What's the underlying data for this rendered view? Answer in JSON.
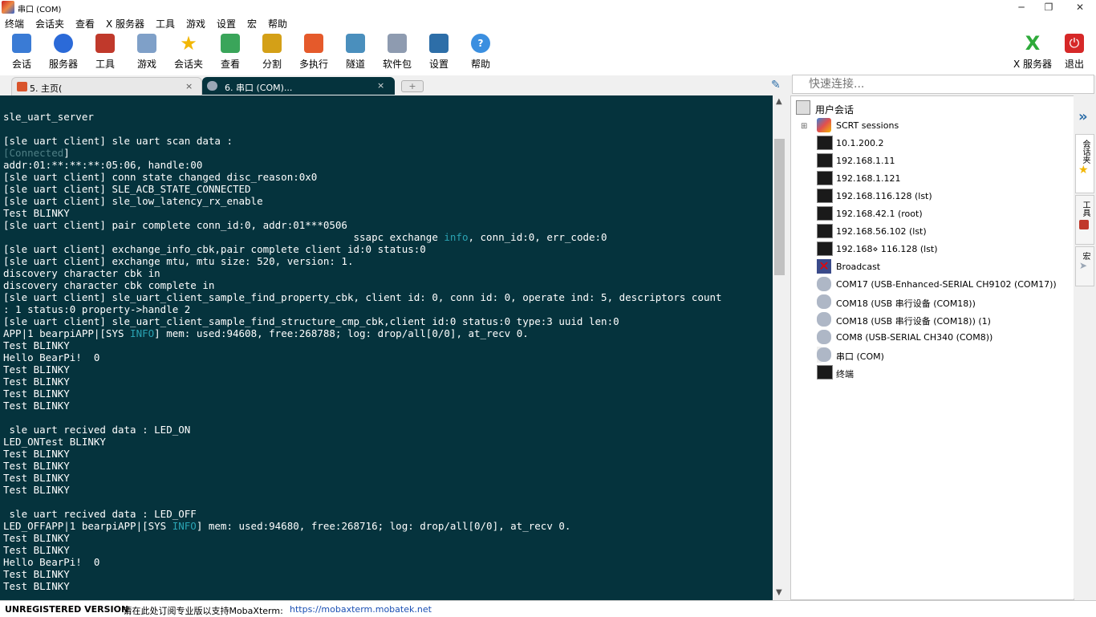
{
  "window": {
    "title": "串口 (COM)",
    "minimize": "─",
    "maximize": "❐",
    "close": "✕"
  },
  "menu": [
    "终端",
    "会话夹",
    "查看",
    "X 服务器",
    "工具",
    "游戏",
    "设置",
    "宏",
    "帮助"
  ],
  "toolbar": {
    "left": [
      {
        "label": "会话",
        "icon": "session-icon",
        "color": "#3a7bd5"
      },
      {
        "label": "服务器",
        "icon": "globe-icon",
        "color": "#2b6ad8"
      },
      {
        "label": "工具",
        "icon": "tools-icon",
        "color": "#c0392b"
      },
      {
        "label": "游戏",
        "icon": "gamepad-icon",
        "color": "#7fa0c8"
      },
      {
        "label": "会话夹",
        "icon": "star-icon",
        "color": "#f2b705"
      },
      {
        "label": "查看",
        "icon": "view-icon",
        "color": "#3aa55a"
      },
      {
        "label": "分割",
        "icon": "split-icon",
        "color": "#d4a017"
      },
      {
        "label": "多执行",
        "icon": "multiexec-icon",
        "color": "#e55a2b"
      },
      {
        "label": "隧道",
        "icon": "tunnel-icon",
        "color": "#4a8fbd"
      },
      {
        "label": "软件包",
        "icon": "packages-icon",
        "color": "#8e9bb0"
      },
      {
        "label": "设置",
        "icon": "settings-icon",
        "color": "#2d6ea8"
      },
      {
        "label": "帮助",
        "icon": "help-icon",
        "color": "#3b8fe0"
      }
    ],
    "right": [
      {
        "label": "X 服务器",
        "icon": "xserver-icon",
        "color": "#2eaa3a"
      },
      {
        "label": "退出",
        "icon": "power-icon",
        "color": "#d62828"
      }
    ]
  },
  "tabs": [
    {
      "label": "5. 主页(",
      "close": "×",
      "icon": "home-icon"
    },
    {
      "label": "6. 串口 (COM)...",
      "close": "×",
      "icon": "serial-icon"
    }
  ],
  "terminal": {
    "lines": [
      [
        {
          "t": "sle_uart_server"
        }
      ],
      [
        {
          "t": ""
        }
      ],
      [
        {
          "t": "[sle uart client] sle uart scan data :"
        }
      ],
      [
        {
          "t": "[",
          "c": "g"
        },
        {
          "t": "Connected",
          "c": "g"
        },
        {
          "t": "]"
        }
      ],
      [
        {
          "t": "addr:01:**:**:**:05:06, handle:00"
        }
      ],
      [
        {
          "t": "[sle uart client] conn state changed disc_reason:0x0"
        }
      ],
      [
        {
          "t": "[sle uart client] SLE_ACB_STATE_CONNECTED"
        }
      ],
      [
        {
          "t": "[sle uart client] sle_low_latency_rx_enable"
        }
      ],
      [
        {
          "t": "Test BLINKY"
        }
      ],
      [
        {
          "t": "[sle uart client] pair complete conn_id:0, addr:01***0506"
        }
      ],
      [
        {
          "t": "                                                          ssapc exchange "
        },
        {
          "t": "info",
          "c": "i"
        },
        {
          "t": ", conn_id:0, err_code:0"
        }
      ],
      [
        {
          "t": "[sle uart client] exchange_info_cbk,pair complete client id:0 status:0"
        }
      ],
      [
        {
          "t": "[sle uart client] exchange mtu, mtu size: 520, version: 1."
        }
      ],
      [
        {
          "t": "discovery character cbk in"
        }
      ],
      [
        {
          "t": "discovery character cbk complete in"
        }
      ],
      [
        {
          "t": "[sle uart client] sle_uart_client_sample_find_property_cbk, client id: 0, conn id: 0, operate ind: 5, descriptors count"
        }
      ],
      [
        {
          "t": ": 1 status:0 property->handle 2"
        }
      ],
      [
        {
          "t": "[sle uart client] sle_uart_client_sample_find_structure_cmp_cbk,client id:0 status:0 type:3 uuid len:0"
        }
      ],
      [
        {
          "t": "APP|1 bearpiAPP|[SYS "
        },
        {
          "t": "INFO",
          "c": "i"
        },
        {
          "t": "] mem: used:94608, free:268788; log: drop/all[0/0], at_recv 0."
        }
      ],
      [
        {
          "t": "Test BLINKY"
        }
      ],
      [
        {
          "t": "Hello BearPi!  0"
        }
      ],
      [
        {
          "t": "Test BLINKY"
        }
      ],
      [
        {
          "t": "Test BLINKY"
        }
      ],
      [
        {
          "t": "Test BLINKY"
        }
      ],
      [
        {
          "t": "Test BLINKY"
        }
      ],
      [
        {
          "t": ""
        }
      ],
      [
        {
          "t": " sle uart recived data : LED_ON"
        }
      ],
      [
        {
          "t": "LED_ONTest BLINKY"
        }
      ],
      [
        {
          "t": "Test BLINKY"
        }
      ],
      [
        {
          "t": "Test BLINKY"
        }
      ],
      [
        {
          "t": "Test BLINKY"
        }
      ],
      [
        {
          "t": "Test BLINKY"
        }
      ],
      [
        {
          "t": ""
        }
      ],
      [
        {
          "t": " sle uart recived data : LED_OFF"
        }
      ],
      [
        {
          "t": "LED_OFFAPP|1 bearpiAPP|[SYS "
        },
        {
          "t": "INFO",
          "c": "i"
        },
        {
          "t": "] mem: used:94680, free:268716; log: drop/all[0/0], at_recv 0."
        }
      ],
      [
        {
          "t": "Test BLINKY"
        }
      ],
      [
        {
          "t": "Test BLINKY"
        }
      ],
      [
        {
          "t": "Hello BearPi!  0"
        }
      ],
      [
        {
          "t": "Test BLINKY"
        }
      ],
      [
        {
          "t": "Test BLINKY"
        }
      ]
    ]
  },
  "quick_connect": {
    "placeholder": "快速连接..."
  },
  "sessions": {
    "root": "用户会话",
    "folder": "SCRT sessions",
    "expander": "⊞",
    "items": [
      {
        "label": "10.1.200.2",
        "icon": "terminal-icon"
      },
      {
        "label": "192.168.1.11",
        "icon": "terminal-icon"
      },
      {
        "label": "192.168.1.121",
        "icon": "terminal-icon"
      },
      {
        "label": "192.168.116.128 (lst)",
        "icon": "terminal-icon"
      },
      {
        "label": "192.168.42.1 (root)",
        "icon": "terminal-icon"
      },
      {
        "label": "192.168.56.102 (lst)",
        "icon": "terminal-icon"
      },
      {
        "label": "192.168⋄ 116.128 (lst)",
        "icon": "terminal-icon"
      },
      {
        "label": "Broadcast",
        "icon": "broadcast-icon"
      },
      {
        "label": "COM17  (USB-Enhanced-SERIAL CH9102 (COM17))",
        "icon": "serial-port-icon"
      },
      {
        "label": "COM18  (USB 串行设备 (COM18))",
        "icon": "serial-port-icon"
      },
      {
        "label": "COM18  (USB 串行设备 (COM18)) (1)",
        "icon": "serial-port-icon"
      },
      {
        "label": "COM8  (USB-SERIAL CH340 (COM8))",
        "icon": "serial-port-icon"
      },
      {
        "label": "串口 (COM)",
        "icon": "serial-port-icon"
      },
      {
        "label": "终端",
        "icon": "terminal-icon"
      }
    ]
  },
  "side_tabs": {
    "arrow": "»",
    "favorites": "会话夹",
    "tools": "工具",
    "macros": "宏"
  },
  "status": {
    "unregistered": "UNREGISTERED VERSION",
    "message": " - 请在此处订阅专业版以支持MobaXterm:",
    "link": "https://mobaxterm.mobatek.net"
  }
}
